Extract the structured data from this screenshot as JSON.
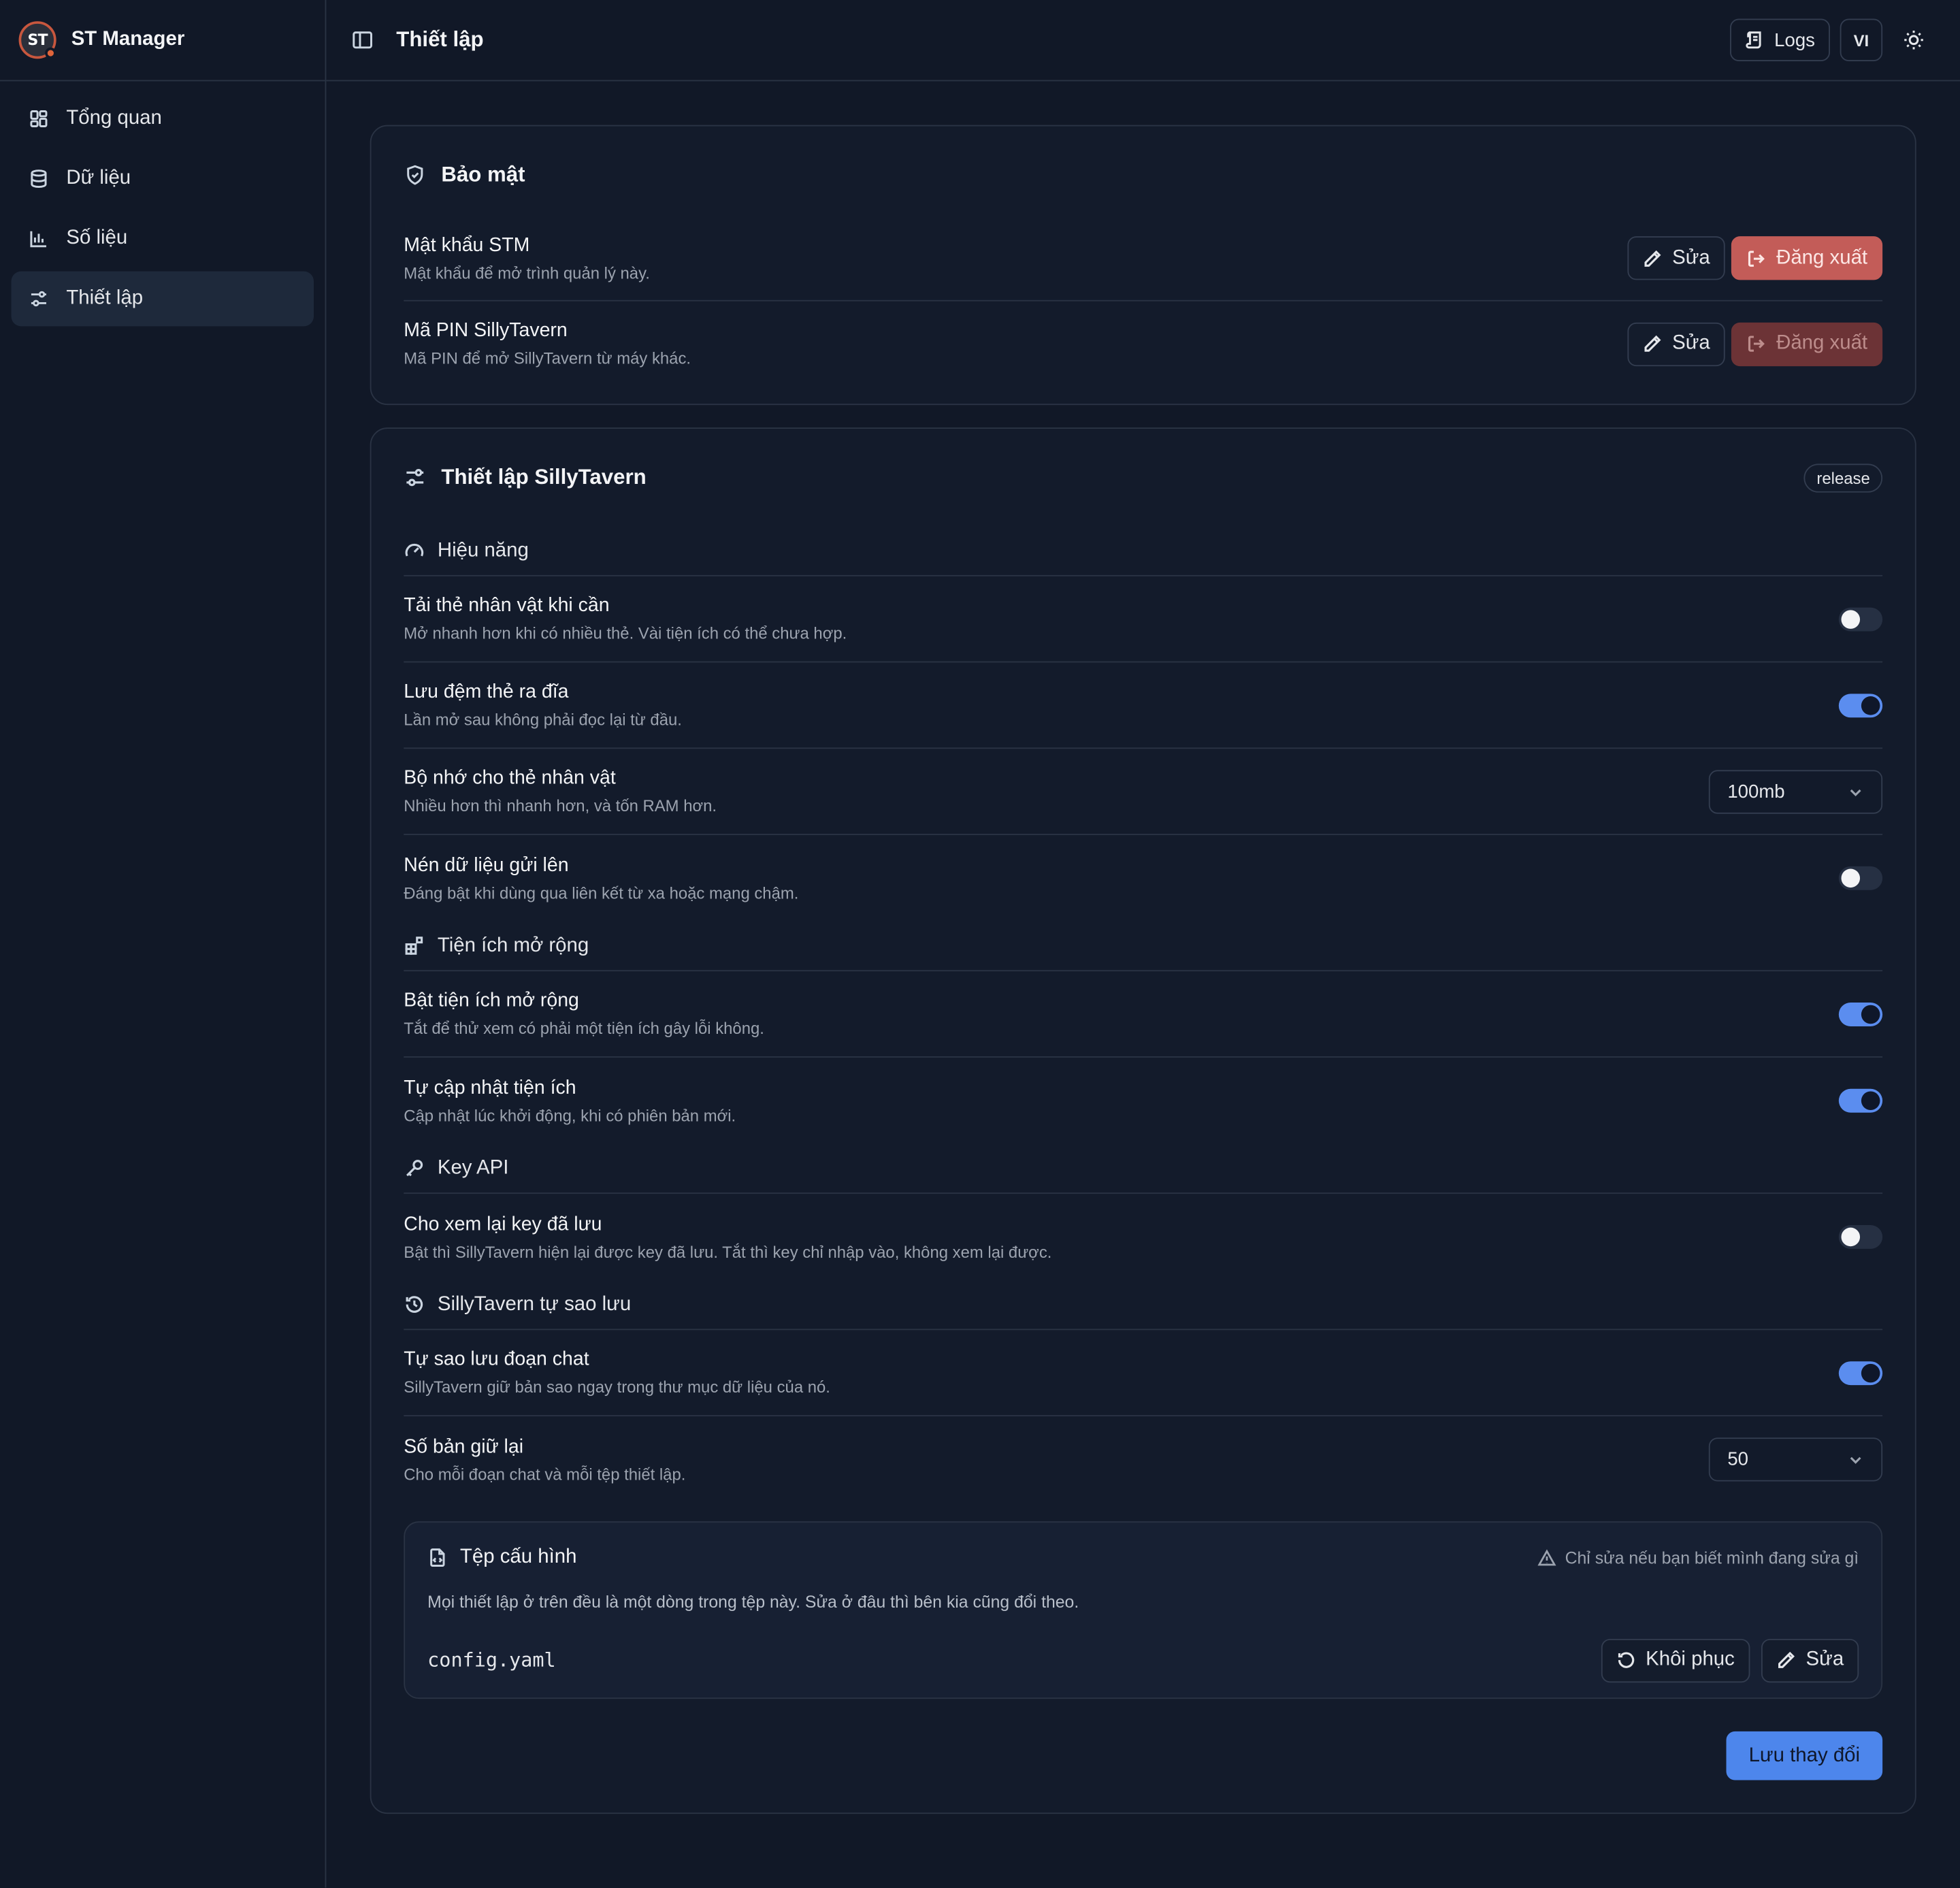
{
  "app": {
    "logo_text": "ST",
    "name": "ST Manager"
  },
  "sidebar": {
    "items": [
      {
        "label": "Tổng quan",
        "icon": "dashboard-icon",
        "active": false
      },
      {
        "label": "Dữ liệu",
        "icon": "database-icon",
        "active": false
      },
      {
        "label": "Số liệu",
        "icon": "bar-chart-icon",
        "active": false
      },
      {
        "label": "Thiết lập",
        "icon": "sliders-icon",
        "active": true
      }
    ]
  },
  "topbar": {
    "title": "Thiết lập",
    "logs_label": "Logs",
    "lang_label": "VI"
  },
  "security": {
    "title": "Bảo mật",
    "rows": [
      {
        "title": "Mật khẩu STM",
        "desc": "Mật khẩu để mở trình quản lý này.",
        "edit_label": "Sửa",
        "logout_label": "Đăng xuất",
        "logout_enabled": true
      },
      {
        "title": "Mã PIN SillyTavern",
        "desc": "Mã PIN để mở SillyTavern từ máy khác.",
        "edit_label": "Sửa",
        "logout_label": "Đăng xuất",
        "logout_enabled": false
      }
    ]
  },
  "st_settings": {
    "title": "Thiết lập SillyTavern",
    "badge": "release",
    "sections": {
      "performance": {
        "title": "Hiệu năng",
        "rows": [
          {
            "title": "Tải thẻ nhân vật khi cần",
            "desc": "Mở nhanh hơn khi có nhiều thẻ. Vài tiện ích có thể chưa hợp.",
            "on": false
          },
          {
            "title": "Lưu đệm thẻ ra đĩa",
            "desc": "Lần mở sau không phải đọc lại từ đầu.",
            "on": true
          },
          {
            "title": "Bộ nhớ cho thẻ nhân vật",
            "desc": "Nhiều hơn thì nhanh hơn, và tốn RAM hơn.",
            "select": "100mb"
          },
          {
            "title": "Nén dữ liệu gửi lên",
            "desc": "Đáng bật khi dùng qua liên kết từ xa hoặc mạng chậm.",
            "on": false
          }
        ]
      },
      "extensions": {
        "title": "Tiện ích mở rộng",
        "rows": [
          {
            "title": "Bật tiện ích mở rộng",
            "desc": "Tắt để thử xem có phải một tiện ích gây lỗi không.",
            "on": true
          },
          {
            "title": "Tự cập nhật tiện ích",
            "desc": "Cập nhật lúc khởi động, khi có phiên bản mới.",
            "on": true
          }
        ]
      },
      "api": {
        "title": "Key API",
        "rows": [
          {
            "title": "Cho xem lại key đã lưu",
            "desc": "Bật thì SillyTavern hiện lại được key đã lưu. Tắt thì key chỉ nhập vào, không xem lại được.",
            "on": false
          }
        ]
      },
      "backup": {
        "title": "SillyTavern tự sao lưu",
        "rows": [
          {
            "title": "Tự sao lưu đoạn chat",
            "desc": "SillyTavern giữ bản sao ngay trong thư mục dữ liệu của nó.",
            "on": true
          },
          {
            "title": "Số bản giữ lại",
            "desc": "Cho mỗi đoạn chat và mỗi tệp thiết lập.",
            "select": "50"
          }
        ]
      }
    },
    "config": {
      "title": "Tệp cấu hình",
      "warning": "Chỉ sửa nếu bạn biết mình đang sửa gì",
      "desc": "Mọi thiết lập ở trên đều là một dòng trong tệp này. Sửa ở đâu thì bên kia cũng đổi theo.",
      "file": "config.yaml",
      "restore_label": "Khôi phục",
      "edit_label": "Sửa"
    },
    "save_label": "Lưu thay đổi"
  },
  "colors": {
    "background": "#111827",
    "accent": "#4d86ec",
    "danger": "#c35c58"
  }
}
